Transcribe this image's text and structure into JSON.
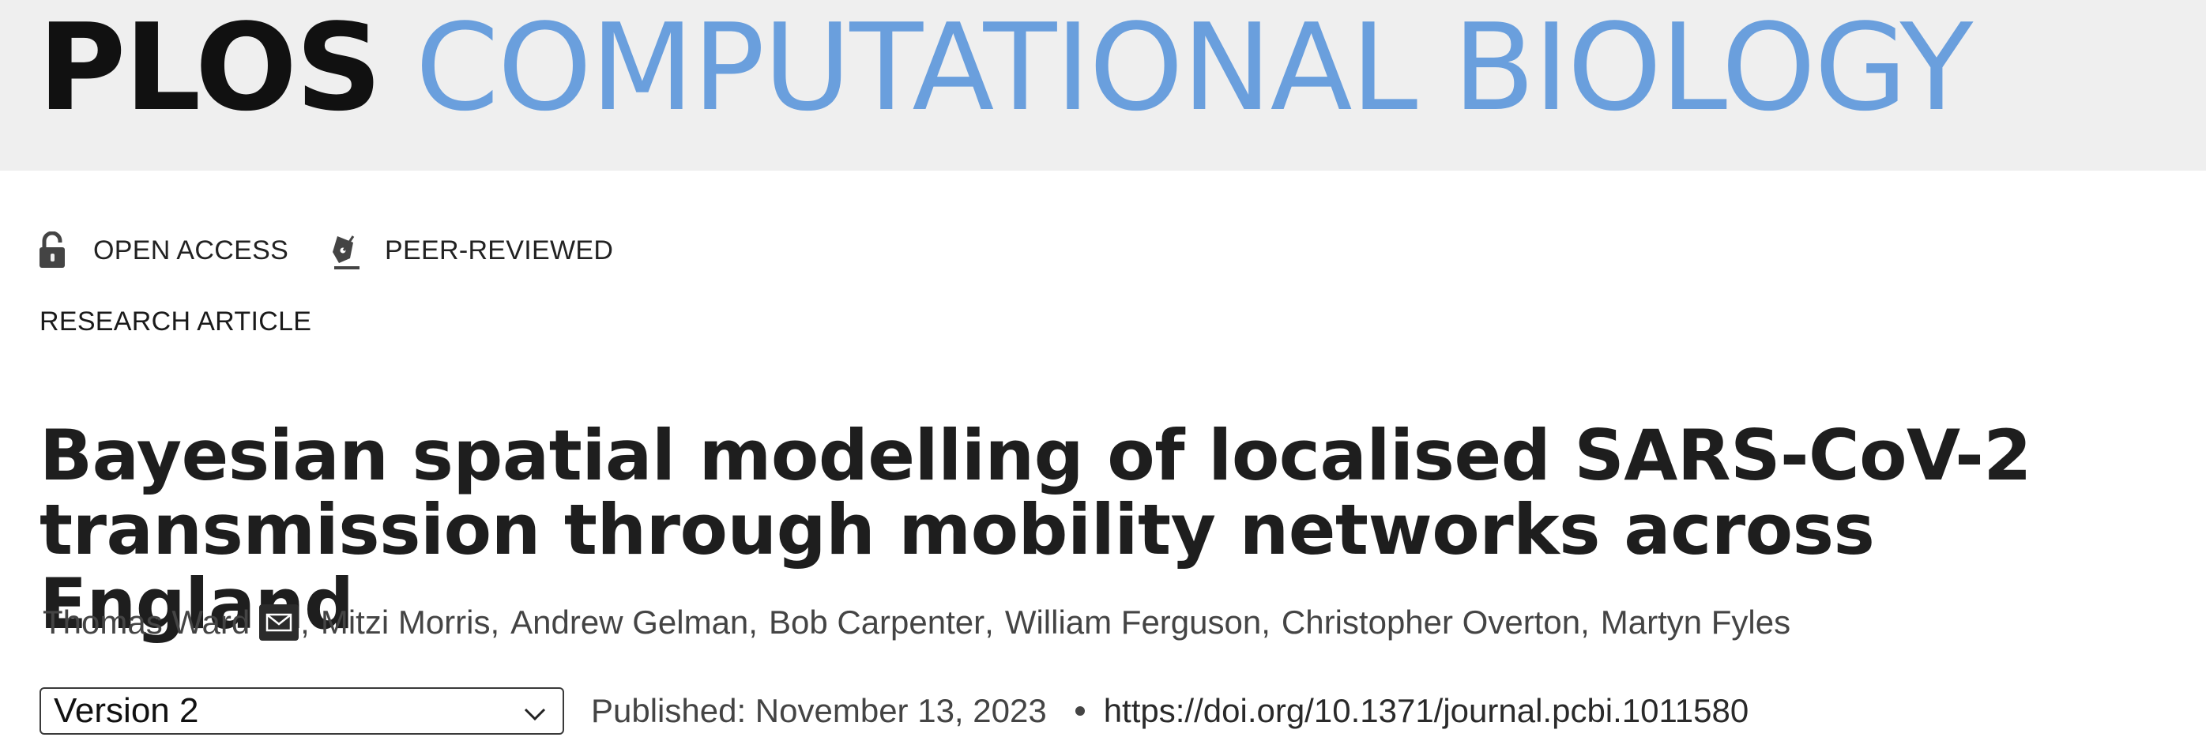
{
  "header": {
    "logo_publisher": "PLOS",
    "logo_journal": "COMPUTATIONAL BIOLOGY",
    "publisher_color": "#111111",
    "journal_color": "#6a9fdd",
    "background": "#efefef"
  },
  "badges": [
    {
      "icon": "open-lock-icon",
      "label": "OPEN ACCESS"
    },
    {
      "icon": "pen-nib-icon",
      "label": "PEER-REVIEWED"
    }
  ],
  "article": {
    "type": "RESEARCH ARTICLE",
    "title_line1": "Bayesian spatial modelling of localised SARS-CoV-2",
    "title_line2": "transmission through mobility networks across England"
  },
  "authors": [
    {
      "name": "Thomas Ward",
      "corresponding": true,
      "icon": "envelope-icon"
    },
    {
      "name": "Mitzi Morris"
    },
    {
      "name": "Andrew Gelman"
    },
    {
      "name": "Bob Carpenter"
    },
    {
      "name": "William Ferguson"
    },
    {
      "name": "Christopher Overton"
    },
    {
      "name": "Martyn Fyles"
    }
  ],
  "separator": ",",
  "version_select": {
    "selected": "Version 2",
    "icon": "chevron-down-icon"
  },
  "publication": {
    "published": "Published: November 13, 2023",
    "doi": "https://doi.org/10.1371/journal.pcbi.1011580"
  }
}
